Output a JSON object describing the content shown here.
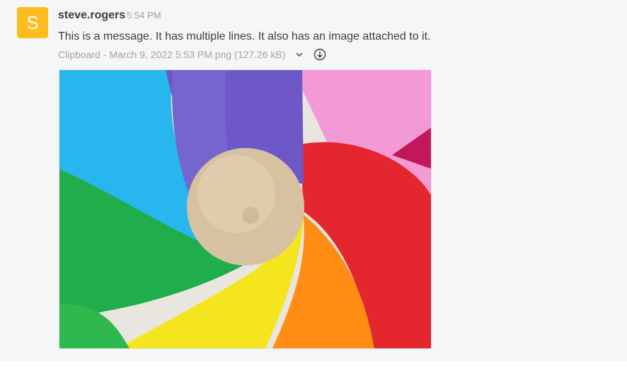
{
  "post": {
    "avatar_letter": "S",
    "avatar_color": "#ffbc1f",
    "username": "steve.rogers",
    "time": "5:54 PM",
    "message": "This is a message. It has multiple lines. It also has an image attached to it.",
    "attachment": {
      "name": "Clipboard - March 9, 2022 5:53 PM.png",
      "size": "(127.26 kB)",
      "icons": [
        "chevron-down-icon",
        "download-icon"
      ]
    }
  }
}
